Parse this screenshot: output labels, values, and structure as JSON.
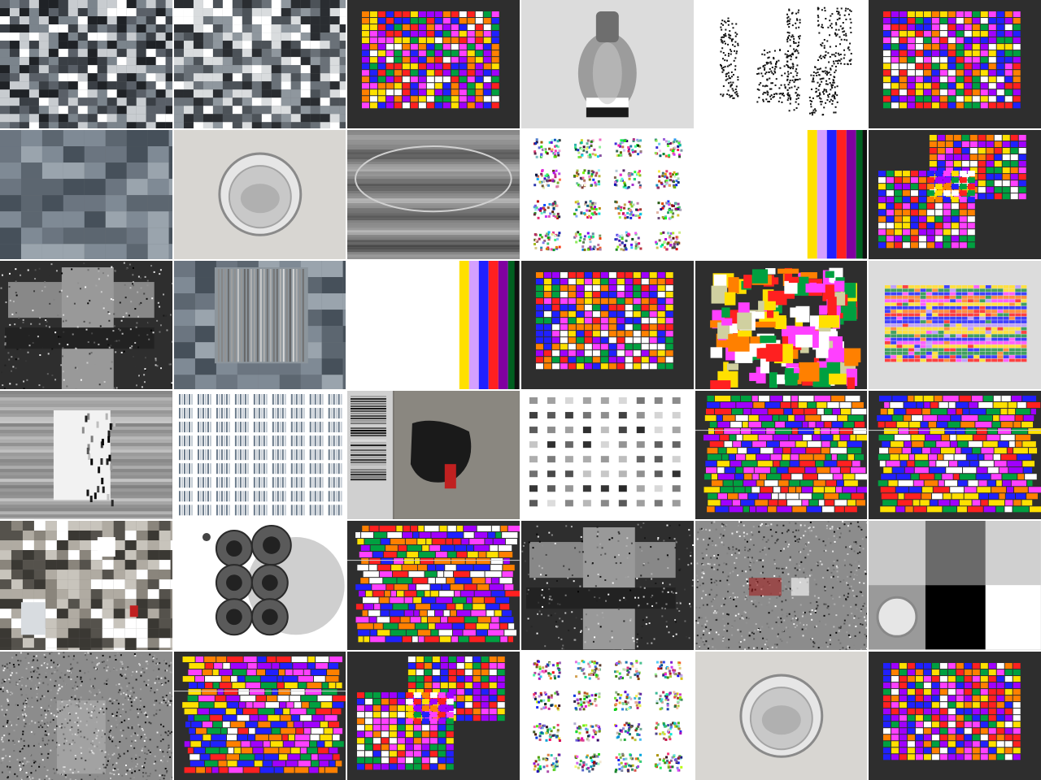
{
  "grid": {
    "rows": 6,
    "cols": 6
  },
  "tiles": [
    {
      "kind": "noise-photo",
      "bg": "bg-stone",
      "palette": [
        "#3a3f45",
        "#7b848c",
        "#c8ccd0",
        "#ffffff",
        "#1f2226",
        "#5a6068"
      ]
    },
    {
      "kind": "noise-photo",
      "bg": "bg-stone",
      "palette": [
        "#4c5258",
        "#8f979e",
        "#d9dcde",
        "#ffffff",
        "#2a2d31",
        "#6a7178"
      ]
    },
    {
      "kind": "color-grid",
      "bg": "bg-dark",
      "palette": [
        "#ff2020",
        "#ffe000",
        "#ff40ff",
        "#2020ff",
        "#ff8000",
        "#a000ff",
        "#00a040",
        "#ffffff"
      ]
    },
    {
      "kind": "bottle",
      "bg": "bg-light"
    },
    {
      "kind": "silhouettes",
      "bg": "bg-white"
    },
    {
      "kind": "color-grid",
      "bg": "bg-dark",
      "palette": [
        "#ff2020",
        "#ffe000",
        "#ff40ff",
        "#2020ff",
        "#ff8000",
        "#a000ff",
        "#00a040",
        "#ffffff"
      ]
    },
    {
      "kind": "blocks",
      "bg": "bg-stone",
      "palette": [
        "#5c6670",
        "#7f8a95",
        "#9aa4ad",
        "#46505a",
        "#6b7580"
      ]
    },
    {
      "kind": "glass-top",
      "bg": "bg-paper"
    },
    {
      "kind": "water",
      "bg": "bg-mid"
    },
    {
      "kind": "noise-squares",
      "bg": "bg-white"
    },
    {
      "kind": "stripes-right",
      "bg": "bg-white"
    },
    {
      "kind": "color-grid-double",
      "bg": "bg-dark",
      "palette": [
        "#ff2020",
        "#ffe000",
        "#ff40ff",
        "#2020ff",
        "#ff8000",
        "#a000ff",
        "#00a040",
        "#ffffff"
      ]
    },
    {
      "kind": "cross",
      "bg": "bg-dark"
    },
    {
      "kind": "blocks-glitch",
      "bg": "bg-stone",
      "palette": [
        "#5c6670",
        "#7f8a95",
        "#9aa4ad",
        "#46505a",
        "#6b7580"
      ]
    },
    {
      "kind": "stripes-right",
      "bg": "bg-white"
    },
    {
      "kind": "color-grid",
      "bg": "bg-dark",
      "palette": [
        "#ff2020",
        "#ffe000",
        "#ff40ff",
        "#2020ff",
        "#ff8000",
        "#a000ff",
        "#00a040",
        "#ffffff"
      ]
    },
    {
      "kind": "color-scatter",
      "bg": "bg-dark",
      "palette": [
        "#ff2020",
        "#ffe000",
        "#ff40ff",
        "#ff8000",
        "#00a040",
        "#d0d0a0",
        "#ffffff"
      ]
    },
    {
      "kind": "color-rows",
      "bg": "bg-light",
      "palette": [
        "#ff4040",
        "#ffe040",
        "#ff60ff",
        "#4040ff",
        "#ff9040",
        "#40a060",
        "#c0a0ff"
      ]
    },
    {
      "kind": "glass-glitch",
      "bg": "bg-mid"
    },
    {
      "kind": "barcode-grid",
      "bg": "bg-white"
    },
    {
      "kind": "tree-bark",
      "bg": "bg-bark"
    },
    {
      "kind": "icon-grid",
      "bg": "bg-white"
    },
    {
      "kind": "color-rows-glitch",
      "bg": "bg-dark",
      "palette": [
        "#ff2020",
        "#ffe000",
        "#ff40ff",
        "#2020ff",
        "#ff8000",
        "#a000ff",
        "#00a040",
        "#ffffff"
      ]
    },
    {
      "kind": "color-rows-glitch",
      "bg": "bg-dark",
      "palette": [
        "#ff2020",
        "#ffe000",
        "#ff40ff",
        "#2020ff",
        "#ff8000",
        "#a000ff",
        "#00a040",
        "#ffffff"
      ]
    },
    {
      "kind": "bark-blocks",
      "bg": "bg-bark",
      "palette": [
        "#55524c",
        "#8a857c",
        "#b0aba2",
        "#3a3833",
        "#c8c4bc",
        "#ffffff"
      ]
    },
    {
      "kind": "circles",
      "bg": "bg-white"
    },
    {
      "kind": "color-rows-glitch",
      "bg": "bg-dark",
      "palette": [
        "#ff2020",
        "#ffe000",
        "#ff40ff",
        "#2020ff",
        "#ff8000",
        "#a000ff",
        "#00a040",
        "#ffffff"
      ]
    },
    {
      "kind": "cross",
      "bg": "bg-dark"
    },
    {
      "kind": "static-text",
      "bg": "bg-mid"
    },
    {
      "kind": "quad",
      "bg": "bg-light"
    },
    {
      "kind": "static",
      "bg": "bg-mid"
    },
    {
      "kind": "color-rows-glitch",
      "bg": "bg-dark",
      "palette": [
        "#ff2020",
        "#ffe000",
        "#ff40ff",
        "#2020ff",
        "#ff8000",
        "#a000ff",
        "#00a040",
        "#ffffff"
      ]
    },
    {
      "kind": "color-grid-double",
      "bg": "bg-dark",
      "palette": [
        "#ff2020",
        "#ffe000",
        "#ff40ff",
        "#2020ff",
        "#ff8000",
        "#a000ff",
        "#00a040",
        "#ffffff"
      ]
    },
    {
      "kind": "noise-squares",
      "bg": "bg-white"
    },
    {
      "kind": "glass-top",
      "bg": "bg-paper"
    },
    {
      "kind": "color-grid",
      "bg": "bg-dark",
      "palette": [
        "#ff2020",
        "#ffe000",
        "#ff40ff",
        "#2020ff",
        "#ff8000",
        "#a000ff",
        "#00a040",
        "#ffffff"
      ]
    }
  ]
}
